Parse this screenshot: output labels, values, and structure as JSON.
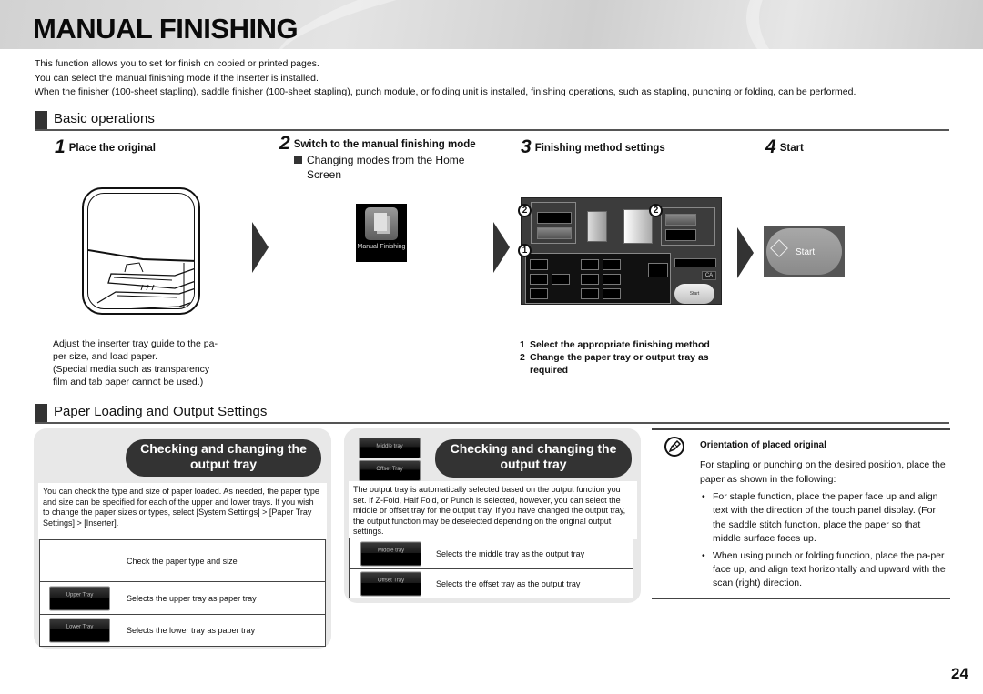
{
  "header": {
    "title": "MANUAL FINISHING"
  },
  "intro": [
    "This function allows you to set for finish on copied or printed pages.",
    "You can select the manual finishing mode if the inserter is installed.",
    "When the finisher (100-sheet stapling), saddle finisher (100-sheet stapling), punch module, or folding unit is installed, finishing operations, such as stapling, punching or folding, can be performed."
  ],
  "basic": {
    "title": "Basic operations",
    "steps": [
      {
        "num": "1",
        "label": "Place the original"
      },
      {
        "num": "2",
        "label": "Switch to the manual finishing mode",
        "sub": "Changing modes from the Home Screen"
      },
      {
        "num": "3",
        "label": "Finishing method settings"
      },
      {
        "num": "4",
        "label": "Start"
      }
    ],
    "home_icon_label": "Manual Finishing",
    "step1_caption": [
      "Adjust the inserter tray guide to the pa-",
      "per size, and load paper.",
      "(Special media such as transparency",
      "film and tab paper cannot be used.)"
    ],
    "step3_list": [
      {
        "n": "1",
        "text": "Select the appropriate finishing method"
      },
      {
        "n": "2",
        "text": "Change the paper tray or output tray as required"
      }
    ],
    "panel": {
      "callout_1": "1",
      "callout_2": "2",
      "ca_label": "CA",
      "start_label": "Start"
    },
    "start_button_label": "Start"
  },
  "paper": {
    "title": "Paper Loading and Output Settings",
    "left_card": {
      "heading": "Checking and changing the output tray",
      "text": "You can check the type and size of paper loaded. As needed, the paper type and size can be specified for each of the upper and lower trays. If you wish to change the paper sizes or types, select [System Settings] > [Paper Tray Settings] > [Inserter].",
      "rows": [
        {
          "button": "",
          "desc": "Check the paper type and size"
        },
        {
          "button": "Upper Tray",
          "desc": "Selects the upper tray as paper tray"
        },
        {
          "button": "Lower Tray",
          "desc": "Selects the lower tray as paper tray"
        }
      ]
    },
    "mid_card": {
      "heading": "Checking and changing the output tray",
      "header_buttons": [
        "Middle tray",
        "Offset Tray"
      ],
      "text": "The output tray is automatically selected based on the output function you set. If Z-Fold, Half Fold, or Punch is selected, however, you can select the middle or offset tray for the output tray. If you have changed the output tray, the output function may be deselected depending on the original output settings.",
      "rows": [
        {
          "button": "Middle tray",
          "desc": "Selects the middle tray as the output tray"
        },
        {
          "button": "Offset Tray",
          "desc": "Selects the offset tray as the output tray"
        }
      ]
    },
    "note": {
      "title": "Orientation of placed original",
      "intro": "For stapling or punching on the desired position, place the paper as shown in the following:",
      "bullets": [
        "For staple function, place the paper face up and align text with the direction of the touch panel display. (For the saddle stitch function, place the paper so that middle surface faces up.",
        "When using punch or folding function, place the pa-per face up, and align text horizontally and upward with the scan (right) direction."
      ]
    }
  },
  "page_number": "24"
}
